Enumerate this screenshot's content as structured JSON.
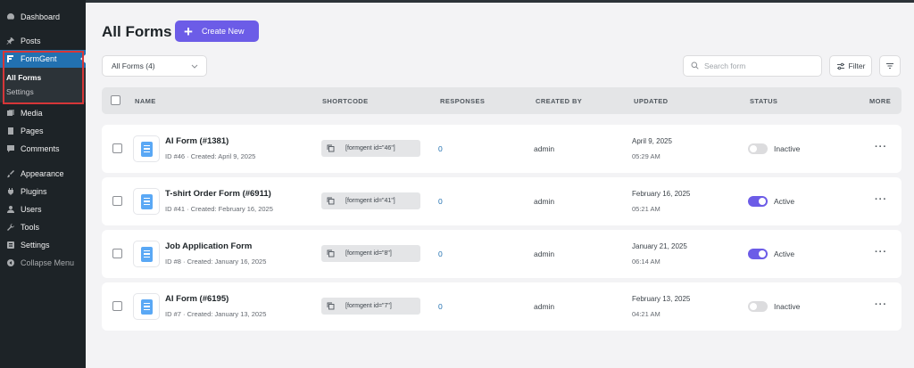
{
  "sidebar": {
    "items": [
      {
        "label": "Dashboard",
        "icon": "dashboard-icon"
      },
      {
        "label": "Posts",
        "icon": "pin-icon"
      },
      {
        "label": "FormGent",
        "icon": "formgent-icon"
      },
      {
        "label": "Media",
        "icon": "media-icon"
      },
      {
        "label": "Pages",
        "icon": "pages-icon"
      },
      {
        "label": "Comments",
        "icon": "comments-icon"
      },
      {
        "label": "Appearance",
        "icon": "brush-icon"
      },
      {
        "label": "Plugins",
        "icon": "plugin-icon"
      },
      {
        "label": "Users",
        "icon": "users-icon"
      },
      {
        "label": "Tools",
        "icon": "wrench-icon"
      },
      {
        "label": "Settings",
        "icon": "settings-icon"
      }
    ],
    "submenu": [
      "All Forms",
      "Settings"
    ],
    "collapse_label": "Collapse Menu"
  },
  "header": {
    "title": "All Forms",
    "create_label": "Create New"
  },
  "toolbar": {
    "select_value": "All Forms (4)",
    "search_placeholder": "Search form",
    "filter_label": "Filter"
  },
  "table": {
    "columns": [
      "NAME",
      "SHORTCODE",
      "RESPONSES",
      "CREATED BY",
      "UPDATED",
      "STATUS",
      "MORE"
    ],
    "rows": [
      {
        "name": "AI Form (#1381)",
        "meta": "ID #46 · Created: April 9, 2025",
        "shortcode": "[formgent id=\"46\"]",
        "responses": "0",
        "created_by": "admin",
        "updated_date": "April 9, 2025",
        "updated_time": "05:29 AM",
        "status": "Inactive",
        "active": false
      },
      {
        "name": "T-shirt Order Form (#6911)",
        "meta": "ID #41 · Created: February 16, 2025",
        "shortcode": "[formgent id=\"41\"]",
        "responses": "0",
        "created_by": "admin",
        "updated_date": "February 16, 2025",
        "updated_time": "05:21 AM",
        "status": "Active",
        "active": true
      },
      {
        "name": "Job Application Form",
        "meta": "ID #8 · Created: January 16, 2025",
        "shortcode": "[formgent id=\"8\"]",
        "responses": "0",
        "created_by": "admin",
        "updated_date": "January 21, 2025",
        "updated_time": "06:14 AM",
        "status": "Active",
        "active": true
      },
      {
        "name": "AI Form (#6195)",
        "meta": "ID #7 · Created: January 13, 2025",
        "shortcode": "[formgent id=\"7\"]",
        "responses": "0",
        "created_by": "admin",
        "updated_date": "February 13, 2025",
        "updated_time": "04:21 AM",
        "status": "Inactive",
        "active": false
      }
    ],
    "more_label": "···"
  },
  "colors": {
    "accent": "#6c5ce7",
    "wp_blue": "#2271b1",
    "sidebar_bg": "#1d2327",
    "highlight": "#d63638"
  }
}
